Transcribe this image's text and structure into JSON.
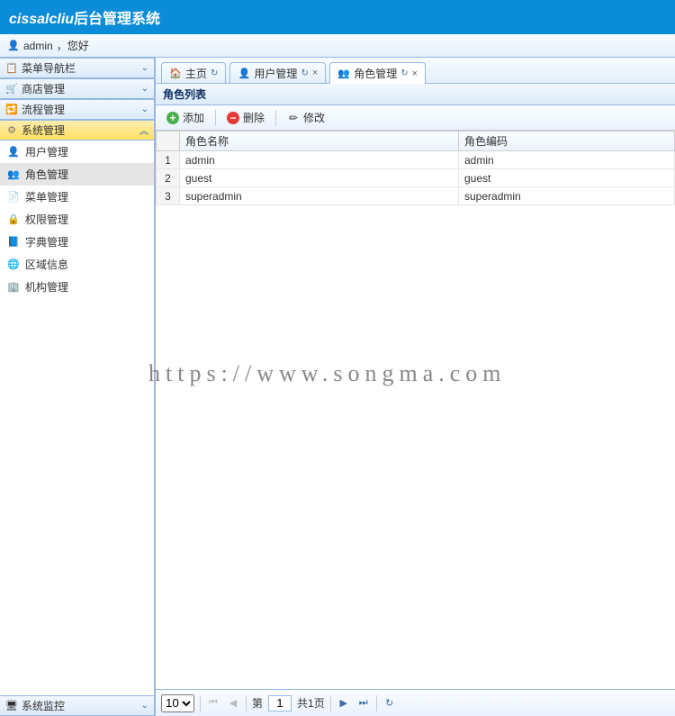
{
  "header": {
    "app_name": "cissalcliu",
    "title_suffix": "后台管理系统"
  },
  "user": {
    "name": "admin",
    "greeting": "，您好"
  },
  "sidebar": {
    "panels": [
      {
        "label": "菜单导航栏",
        "icon": "icon-menu",
        "expanded": false
      },
      {
        "label": "商店管理",
        "icon": "icon-shop",
        "expanded": false
      },
      {
        "label": "流程管理",
        "icon": "icon-flow",
        "expanded": false
      },
      {
        "label": "系统管理",
        "icon": "icon-gear",
        "expanded": true
      }
    ],
    "system_items": [
      {
        "label": "用户管理",
        "icon": "icon-user",
        "selected": false
      },
      {
        "label": "角色管理",
        "icon": "icon-role",
        "selected": true
      },
      {
        "label": "菜单管理",
        "icon": "icon-page",
        "selected": false
      },
      {
        "label": "权限管理",
        "icon": "icon-lock",
        "selected": false
      },
      {
        "label": "字典管理",
        "icon": "icon-book",
        "selected": false
      },
      {
        "label": "区域信息",
        "icon": "icon-globe",
        "selected": false
      },
      {
        "label": "机构管理",
        "icon": "icon-org",
        "selected": false
      }
    ],
    "footer": {
      "label": "系统监控",
      "icon": "icon-monitor"
    }
  },
  "tabs": [
    {
      "label": "主页",
      "icon": "icon-home",
      "closable": false,
      "active": false
    },
    {
      "label": "用户管理",
      "icon": "icon-user",
      "closable": true,
      "active": false
    },
    {
      "label": "角色管理",
      "icon": "icon-role",
      "closable": true,
      "active": true
    }
  ],
  "panel": {
    "title": "角色列表"
  },
  "toolbar": {
    "add_label": "添加",
    "delete_label": "删除",
    "edit_label": "修改"
  },
  "grid": {
    "columns": [
      "角色名称",
      "角色编码"
    ],
    "rows": [
      {
        "num": "1",
        "name": "admin",
        "code": "admin"
      },
      {
        "num": "2",
        "name": "guest",
        "code": "guest"
      },
      {
        "num": "3",
        "name": "superadmin",
        "code": "superadmin"
      }
    ]
  },
  "pager": {
    "page_size": "10",
    "page_label_prefix": "第",
    "current_page": "1",
    "total_label": "共1页"
  },
  "watermark": "https://www.songma.com"
}
